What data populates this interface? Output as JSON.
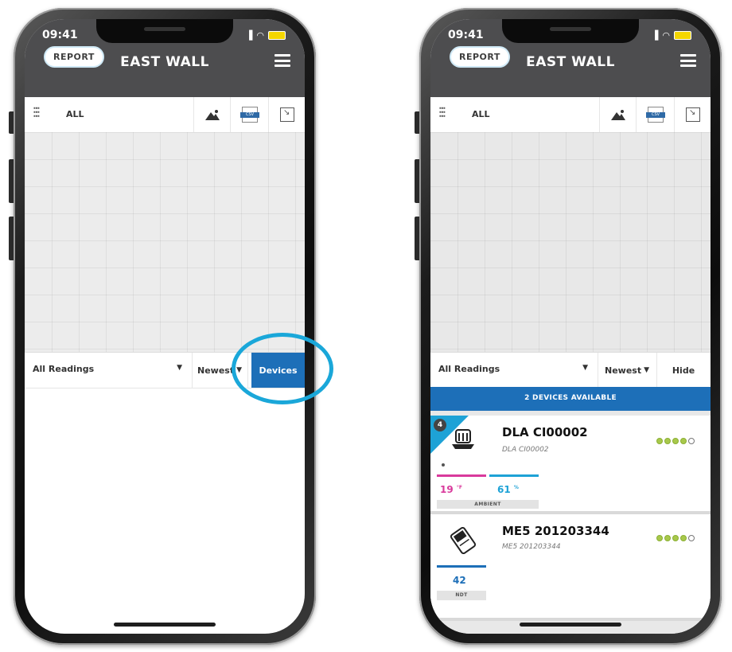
{
  "left_screen": {
    "status": {
      "time": "09:41"
    },
    "header": {
      "report_label": "REPORT",
      "title": "EAST WALL"
    },
    "toolbar": {
      "filter_label": "ALL",
      "csv_label": "CSV"
    },
    "readings_bar": {
      "readings_label": "All Readings",
      "sort_label": "Newest",
      "devices_label": "Devices"
    }
  },
  "right_screen": {
    "status": {
      "time": "09:41"
    },
    "header": {
      "report_label": "REPORT",
      "title": "EAST WALL"
    },
    "toolbar": {
      "filter_label": "ALL",
      "csv_label": "CSV"
    },
    "readings_bar": {
      "readings_label": "All Readings",
      "sort_label": "Newest",
      "hide_label": "Hide"
    },
    "devices_banner": "2 DEVICES AVAILABLE",
    "devices": [
      {
        "badge": "4",
        "name": "DLA CI00002",
        "subtitle": "DLA CI00002",
        "signal_level": 4,
        "signal_max": 5,
        "metrics": [
          {
            "value": "19",
            "unit": "°F",
            "color": "#d93a9c"
          },
          {
            "value": "61",
            "unit": "%",
            "color": "#1ea2d6"
          }
        ],
        "category": "AMBIENT"
      },
      {
        "name": "ME5 201203344",
        "subtitle": "ME5 201203344",
        "signal_level": 4,
        "signal_max": 5,
        "metrics": [
          {
            "value": "42",
            "color": "#1d6fb8"
          }
        ],
        "category": "NDT"
      }
    ]
  },
  "colors": {
    "header_bg": "#4d4d4f",
    "accent_blue": "#1d6fb8",
    "highlight_ring": "#1aa7d9",
    "battery": "#f4d600",
    "signal_green": "#a8c84b"
  }
}
